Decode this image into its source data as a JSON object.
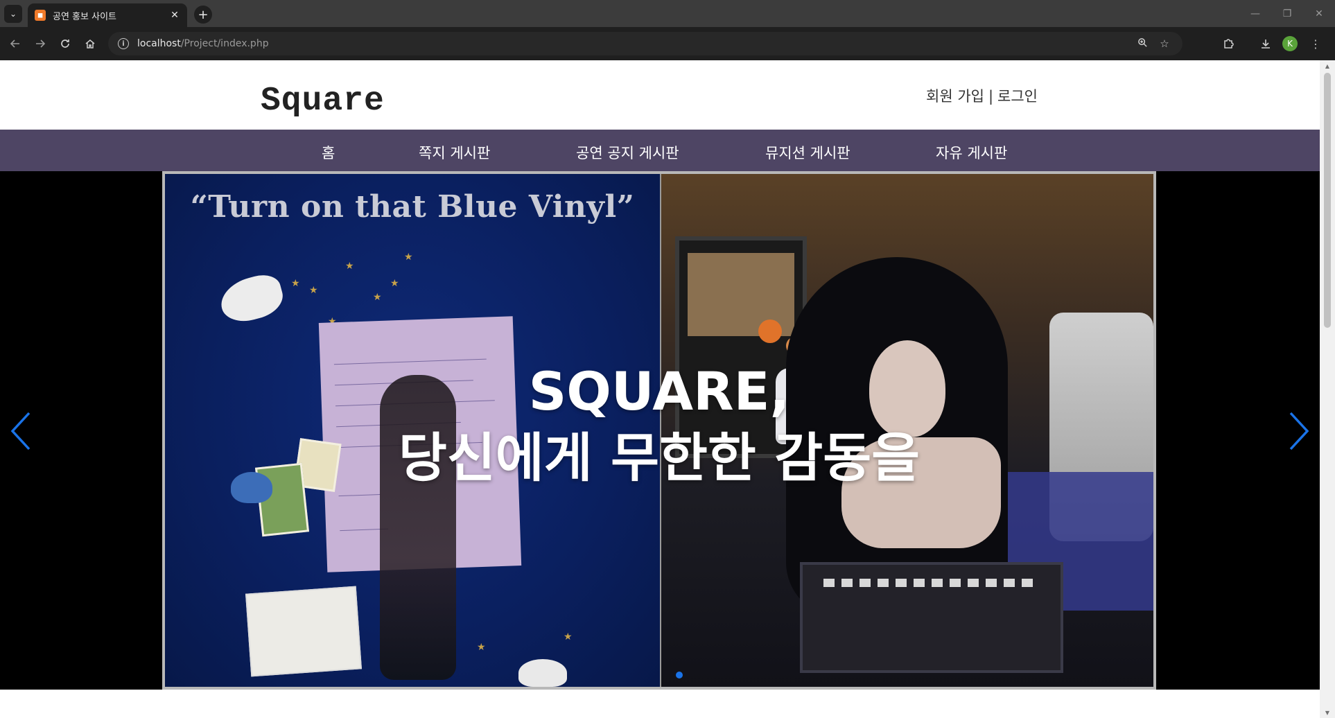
{
  "browser": {
    "tab_title": "공연 홍보 사이트",
    "tab_close": "✕",
    "new_tab": "+",
    "url_host": "localhost",
    "url_path": "/Project/index.php",
    "profile_initial": "K",
    "window_controls": [
      "—",
      "❐",
      "✕"
    ]
  },
  "site": {
    "logo": "Square",
    "auth": {
      "signup": "회원 가입",
      "separator": "|",
      "login": "로그인"
    },
    "nav": [
      {
        "label": "홈"
      },
      {
        "label": "쪽지 게시판"
      },
      {
        "label": "공연 공지 게시판"
      },
      {
        "label": "뮤지션 게시판"
      },
      {
        "label": "자유 게시판"
      }
    ],
    "hero": {
      "line1": "SQUARE,",
      "line2": "당신에게 무한한 감동을",
      "image_left_title": "“Turn on that Blue Vinyl”"
    }
  },
  "colors": {
    "nav_bg": "#4e4564",
    "carousel_bg": "#000000",
    "arrow": "#1a73e8",
    "dot_active": "#1a73e8"
  },
  "icons": {
    "back": "back-arrow-icon",
    "forward": "forward-arrow-icon",
    "reload": "reload-icon",
    "home": "home-icon",
    "site_info": "info-icon",
    "zoom": "zoom-icon",
    "bookmark": "star-icon",
    "extensions": "puzzle-icon",
    "download": "download-icon",
    "menu": "kebab-menu-icon"
  },
  "carousel": {
    "slide_count": 1,
    "active_index": 0
  }
}
